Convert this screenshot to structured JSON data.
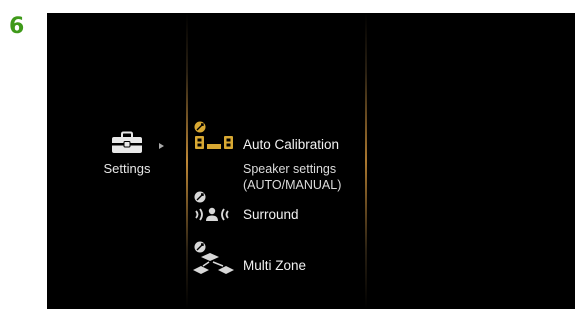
{
  "step_number": "6",
  "category": {
    "label": "Settings",
    "icon": "toolbox-icon"
  },
  "menu": {
    "items": [
      {
        "label": "Auto Calibration",
        "description_lines": [
          "Speaker settings",
          "(AUTO/MANUAL)"
        ],
        "icon": "speaker-calibration-icon",
        "selected": true
      },
      {
        "label": "Surround",
        "icon": "surround-icon",
        "selected": false
      },
      {
        "label": "Multi Zone",
        "icon": "multi-zone-icon",
        "selected": false
      }
    ]
  },
  "colors": {
    "step_number": "#3f9a1a",
    "screen_background": "#000000",
    "selected_icon": "#d9a933",
    "unselected_icon": "#d8d8d8",
    "divider_glow": "#d2963c"
  }
}
